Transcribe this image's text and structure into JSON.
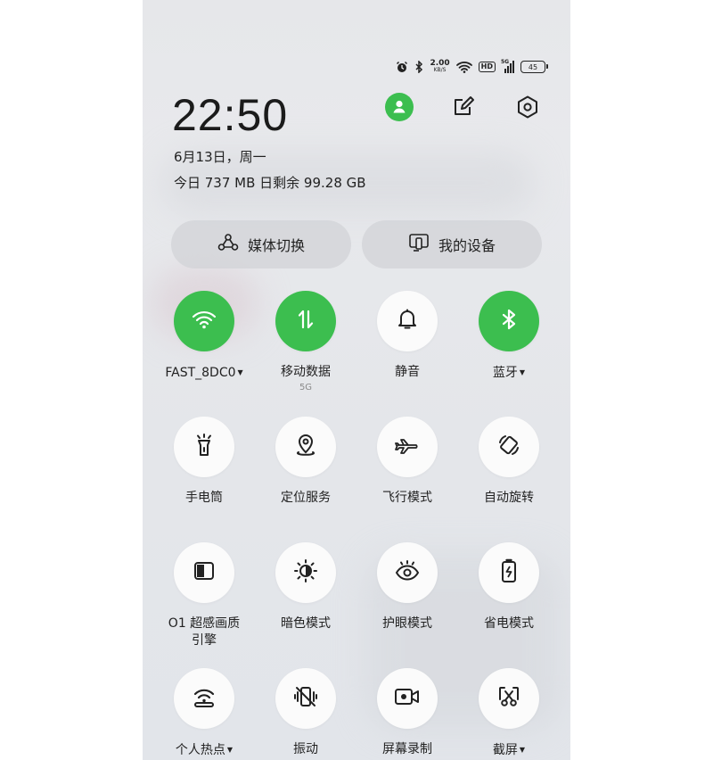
{
  "status_bar": {
    "net_speed": "2.00",
    "net_speed_unit": "KB/S",
    "hd_badge": "HD",
    "network_type": "5G",
    "battery": "45",
    "icons": [
      "alarm-icon",
      "bluetooth-icon",
      "wifi-icon",
      "signal-icon",
      "battery-icon"
    ]
  },
  "header": {
    "time": "22:50",
    "date": "6月13日，周一",
    "data_usage": "今日 737 MB 日剩余 99.28 GB",
    "icons": [
      "user-icon",
      "edit-icon",
      "settings-icon"
    ],
    "accent_color": "#3cbe4f"
  },
  "pills": [
    {
      "label": "媒体切换",
      "icon": "media-switch-icon"
    },
    {
      "label": "我的设备",
      "icon": "my-devices-icon"
    }
  ],
  "tiles": [
    {
      "label": "FAST_8DC0",
      "sub": "",
      "icon": "wifi-icon",
      "active": true,
      "has_menu": true
    },
    {
      "label": "移动数据",
      "sub": "5G",
      "icon": "mobile-data-icon",
      "active": true,
      "has_menu": false
    },
    {
      "label": "静音",
      "sub": "",
      "icon": "bell-icon",
      "active": false,
      "has_menu": false
    },
    {
      "label": "蓝牙",
      "sub": "",
      "icon": "bluetooth-icon",
      "active": true,
      "has_menu": true
    },
    {
      "label": "手电筒",
      "sub": "",
      "icon": "flashlight-icon",
      "active": false,
      "has_menu": false
    },
    {
      "label": "定位服务",
      "sub": "",
      "icon": "location-icon",
      "active": false,
      "has_menu": false
    },
    {
      "label": "飞行模式",
      "sub": "",
      "icon": "airplane-icon",
      "active": false,
      "has_menu": false
    },
    {
      "label": "自动旋转",
      "sub": "",
      "icon": "rotate-icon",
      "active": false,
      "has_menu": false
    },
    {
      "label": "O1 超感画质",
      "label2": "引擎",
      "sub": "",
      "icon": "display-engine-icon",
      "active": false,
      "has_menu": false
    },
    {
      "label": "暗色模式",
      "sub": "",
      "icon": "dark-mode-icon",
      "active": false,
      "has_menu": false
    },
    {
      "label": "护眼模式",
      "sub": "",
      "icon": "eye-icon",
      "active": false,
      "has_menu": false
    },
    {
      "label": "省电模式",
      "sub": "",
      "icon": "battery-saver-icon",
      "active": false,
      "has_menu": false
    },
    {
      "label": "个人热点",
      "sub": "",
      "icon": "hotspot-icon",
      "active": false,
      "has_menu": true
    },
    {
      "label": "振动",
      "sub": "",
      "icon": "vibrate-icon",
      "active": false,
      "has_menu": false
    },
    {
      "label": "屏幕录制",
      "sub": "",
      "icon": "screen-record-icon",
      "active": false,
      "has_menu": false
    },
    {
      "label": "截屏",
      "sub": "",
      "icon": "screenshot-icon",
      "active": false,
      "has_menu": true
    }
  ]
}
